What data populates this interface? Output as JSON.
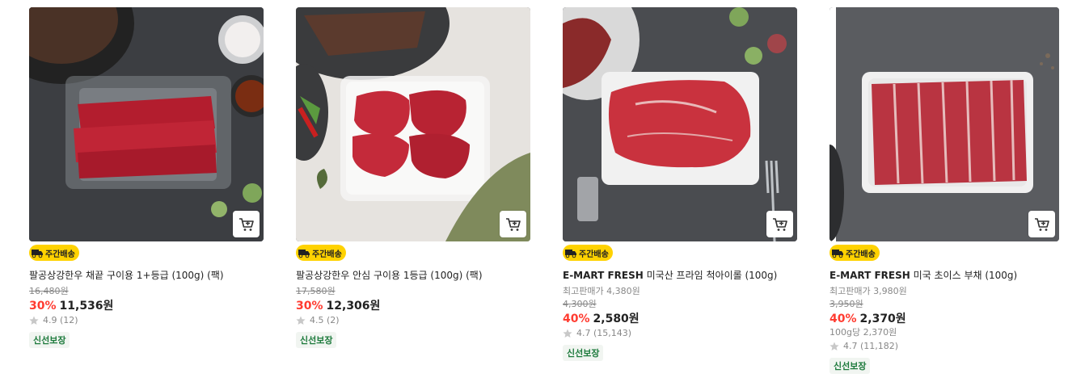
{
  "products": [
    {
      "badge": "주간배송",
      "name": "팔공상강한우 채끝 구이용 1+등급 (100g) (팩)",
      "original_price": "16,480원",
      "discount": "30%",
      "sale_price": "11,536원",
      "rating": "4.9 (12)",
      "fresh_label": "신선보장"
    },
    {
      "badge": "주간배송",
      "name": "팔공상강한우 안심 구이용 1등급 (100g) (팩)",
      "original_price": "17,580원",
      "discount": "30%",
      "sale_price": "12,306원",
      "rating": "4.5 (2)",
      "fresh_label": "신선보장"
    },
    {
      "badge": "주간배송",
      "brand": "E-MART FRESH",
      "name": "미국산 프라임 척아이롤 (100g)",
      "top_price": "최고판매가 4,380원",
      "original_price": "4,300원",
      "discount": "40%",
      "sale_price": "2,580원",
      "rating": "4.7 (15,143)",
      "fresh_label": "신선보장"
    },
    {
      "badge": "주간배송",
      "brand": "E-MART FRESH",
      "name": "미국 초이스 부채 (100g)",
      "top_price": "최고판매가 3,980원",
      "original_price": "3,950원",
      "discount": "40%",
      "sale_price": "2,370원",
      "unit_price": "100g당 2,370원",
      "rating": "4.7 (11,182)",
      "fresh_label": "신선보장"
    }
  ],
  "icons": {
    "cart": "cart-icon",
    "delivery": "delivery-truck-icon",
    "star": "star-icon"
  },
  "colors": {
    "discount": "#ff3b30",
    "badge_bg": "#ffd200",
    "fresh_text": "#1d7a3c",
    "fresh_bg": "#f1f5f1",
    "star": "#c8c8c8"
  }
}
